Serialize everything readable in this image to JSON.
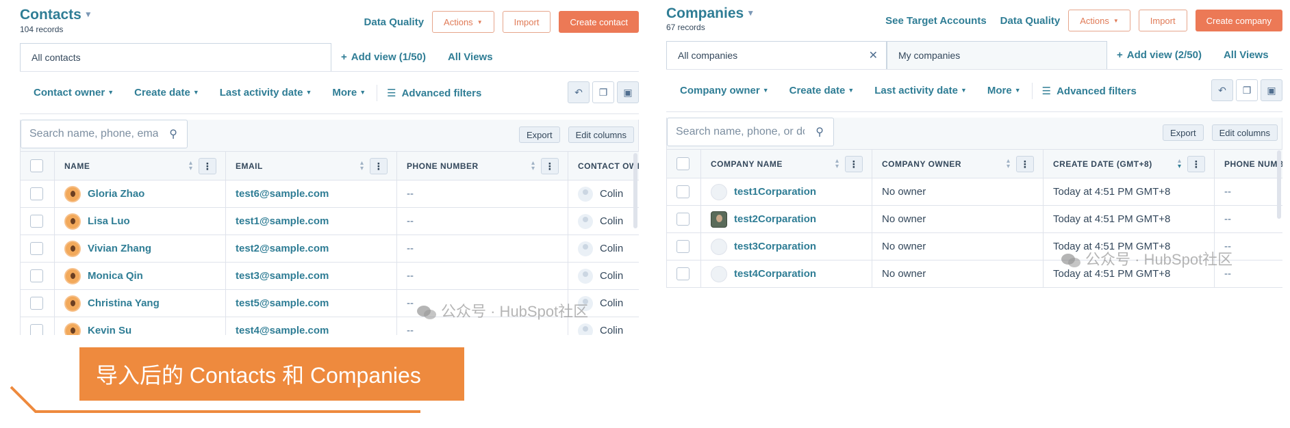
{
  "contacts": {
    "title": "Contacts",
    "records": "104 records",
    "links": {
      "data_quality": "Data Quality"
    },
    "buttons": {
      "actions": "Actions",
      "import": "Import",
      "create": "Create contact"
    },
    "tabs": {
      "active": "All contacts",
      "add_view": "Add view (1/50)",
      "all_views": "All Views"
    },
    "filters": [
      "Contact owner",
      "Create date",
      "Last activity date",
      "More"
    ],
    "advanced_filters": "Advanced filters",
    "search_placeholder": "Search name, phone, email",
    "toolbar": {
      "export": "Export",
      "edit_columns": "Edit columns"
    },
    "columns": [
      "NAME",
      "EMAIL",
      "PHONE NUMBER",
      "CONTACT OWNER"
    ],
    "rows": [
      {
        "name": "Gloria Zhao",
        "email": "test6@sample.com",
        "phone": "--",
        "owner": "Colin"
      },
      {
        "name": "Lisa Luo",
        "email": "test1@sample.com",
        "phone": "--",
        "owner": "Colin"
      },
      {
        "name": "Vivian Zhang",
        "email": "test2@sample.com",
        "phone": "--",
        "owner": "Colin"
      },
      {
        "name": "Monica Qin",
        "email": "test3@sample.com",
        "phone": "--",
        "owner": "Colin"
      },
      {
        "name": "Christina Yang",
        "email": "test5@sample.com",
        "phone": "--",
        "owner": "Colin"
      },
      {
        "name": "Kevin Su",
        "email": "test4@sample.com",
        "phone": "--",
        "owner": "Colin"
      }
    ]
  },
  "companies": {
    "title": "Companies",
    "records": "67 records",
    "links": {
      "see_target": "See Target Accounts",
      "data_quality": "Data Quality"
    },
    "buttons": {
      "actions": "Actions",
      "import": "Import",
      "create": "Create company"
    },
    "tabs": {
      "active": "All companies",
      "second": "My companies",
      "add_view": "Add view (2/50)",
      "all_views": "All Views"
    },
    "filters": [
      "Company owner",
      "Create date",
      "Last activity date",
      "More"
    ],
    "advanced_filters": "Advanced filters",
    "search_placeholder": "Search name, phone, or domain",
    "toolbar": {
      "export": "Export",
      "edit_columns": "Edit columns"
    },
    "columns": [
      "COMPANY NAME",
      "COMPANY OWNER",
      "CREATE DATE (GMT+8)",
      "PHONE NUMBER"
    ],
    "rows": [
      {
        "name": "test1Corparation",
        "owner": "No owner",
        "created": "Today at 4:51 PM GMT+8",
        "phone": "--"
      },
      {
        "name": "test2Corparation",
        "owner": "No owner",
        "created": "Today at 4:51 PM GMT+8",
        "phone": "--"
      },
      {
        "name": "test3Corparation",
        "owner": "No owner",
        "created": "Today at 4:51 PM GMT+8",
        "phone": "--"
      },
      {
        "name": "test4Corparation",
        "owner": "No owner",
        "created": "Today at 4:51 PM GMT+8",
        "phone": "--"
      }
    ]
  },
  "watermark": "公众号 · HubSpot社区",
  "banner": "导入后的 Contacts 和 Companies",
  "colors": {
    "brand_teal": "#2f7d95",
    "primary_button": "#ec7956",
    "banner": "#ee8a3e"
  },
  "icons": [
    "caret-down-icon",
    "plus-icon",
    "close-icon",
    "filter-lines-icon",
    "undo-icon",
    "copy-icon",
    "save-icon",
    "search-icon",
    "kebab-icon",
    "sort-icon",
    "avatar-icon",
    "owner-icon",
    "wechat-icon"
  ]
}
